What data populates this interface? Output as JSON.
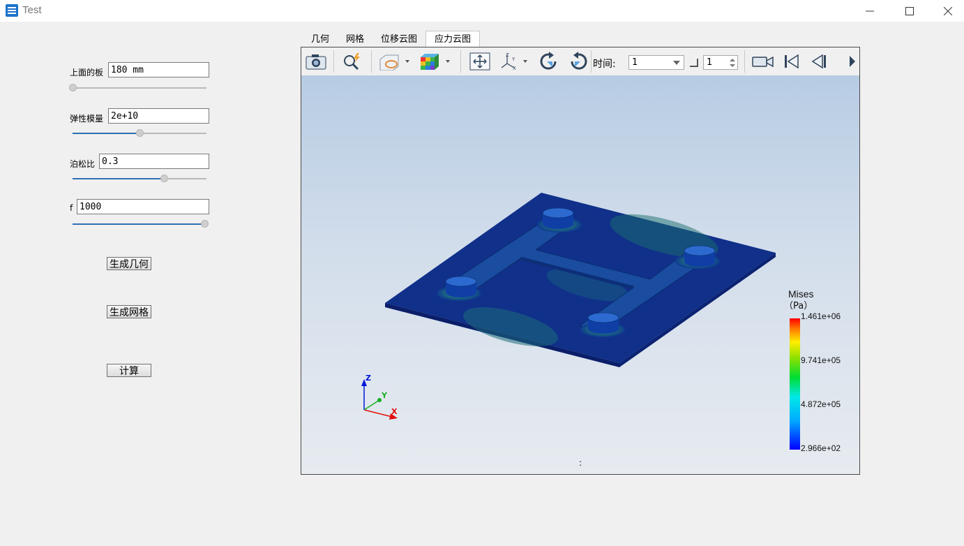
{
  "window": {
    "title": "Test"
  },
  "params": [
    {
      "label": "上面的板",
      "value": "180 mm",
      "slider": 0.0
    },
    {
      "label": "弹性模量",
      "value": "2e+10",
      "slider": 0.5
    },
    {
      "label": "泊松比",
      "value": "0.3",
      "slider": 0.68
    },
    {
      "label": "f",
      "value": "1000",
      "slider": 1.0
    }
  ],
  "buttons": {
    "geometry": "生成几何",
    "mesh": "生成网格",
    "compute": "计算"
  },
  "tabs": [
    {
      "label": "几何",
      "active": false
    },
    {
      "label": "网格",
      "active": false
    },
    {
      "label": "位移云图",
      "active": false
    },
    {
      "label": "应力云图",
      "active": true
    }
  ],
  "toolbar": {
    "time_label": "时间:",
    "time_value": "1",
    "step_value": "1"
  },
  "legend": {
    "title": "Mises",
    "unit": "（Pa）",
    "ticks": [
      "1.461e+06",
      "9.741e+05",
      "4.872e+05",
      "2.966e+02"
    ]
  },
  "triad": {
    "x": "X",
    "y": "Y",
    "z": "Z"
  },
  "status_mark": ":",
  "colors": {
    "accent": "#2f6fb3",
    "app_icon": "#1a73c8"
  }
}
